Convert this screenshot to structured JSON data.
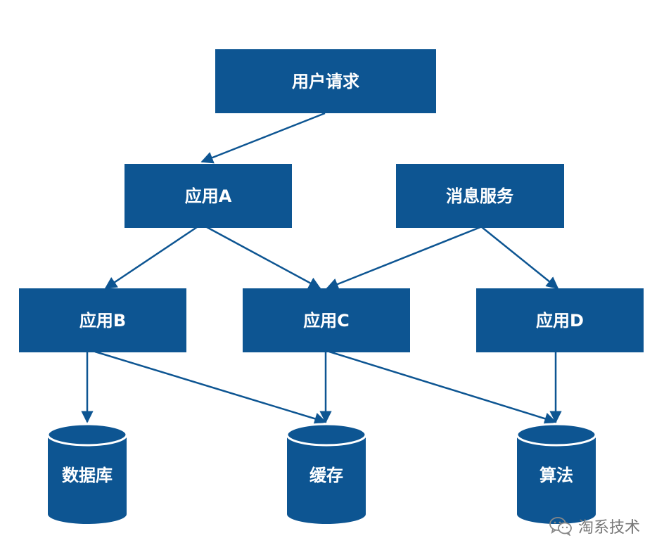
{
  "nodes": {
    "user_request": "用户请求",
    "app_a": "应用A",
    "message_service": "消息服务",
    "app_b": "应用B",
    "app_c": "应用C",
    "app_d": "应用D"
  },
  "stores": {
    "database": "数据库",
    "cache": "缓存",
    "algorithm": "算法"
  },
  "watermark": {
    "text": "淘系技术",
    "icon": "wechat-icon"
  },
  "colors": {
    "box_fill": "#0d5592",
    "label": "#ffffff",
    "watermark": "#777777"
  }
}
